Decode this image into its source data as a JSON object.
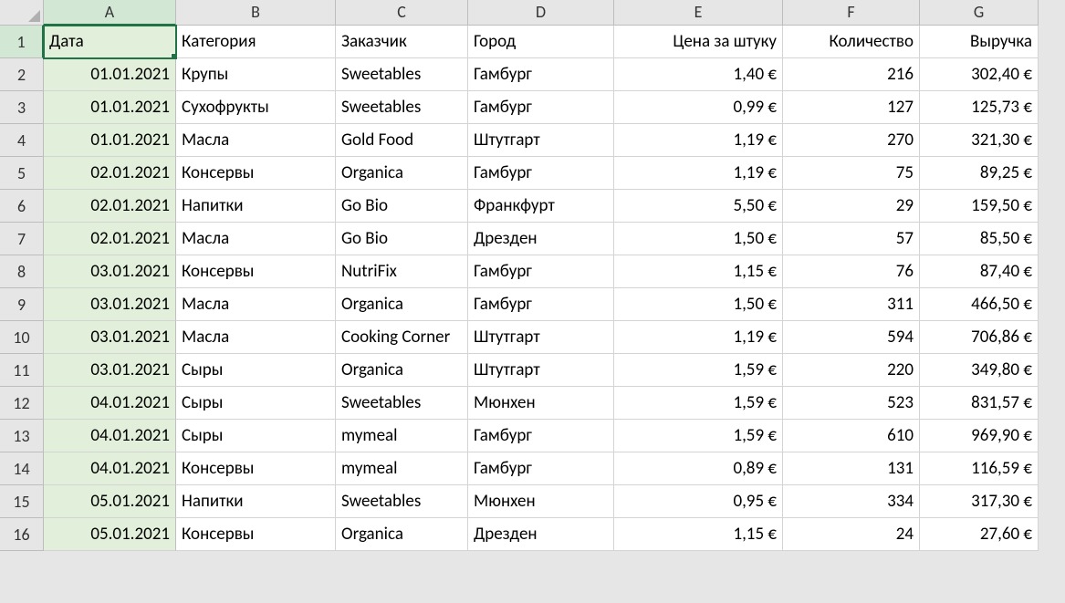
{
  "columns": [
    "A",
    "B",
    "C",
    "D",
    "E",
    "F",
    "G"
  ],
  "selected_column": "A",
  "selected_row": 1,
  "active_cell": "A1",
  "headers": {
    "A": "Дата",
    "B": "Категория",
    "C": "Заказчик",
    "D": "Город",
    "E": "Цена за штуку",
    "F": "Количество",
    "G": "Выручка"
  },
  "rows": [
    {
      "n": 2,
      "A": "01.01.2021",
      "B": "Крупы",
      "C": "Sweetables",
      "D": "Гамбург",
      "E": "1,40 €",
      "F": "216",
      "G": "302,40 €"
    },
    {
      "n": 3,
      "A": "01.01.2021",
      "B": "Сухофрукты",
      "C": "Sweetables",
      "D": "Гамбург",
      "E": "0,99 €",
      "F": "127",
      "G": "125,73 €"
    },
    {
      "n": 4,
      "A": "01.01.2021",
      "B": "Масла",
      "C": "Gold Food",
      "D": "Штутгарт",
      "E": "1,19 €",
      "F": "270",
      "G": "321,30 €"
    },
    {
      "n": 5,
      "A": "02.01.2021",
      "B": "Консервы",
      "C": "Organica",
      "D": "Гамбург",
      "E": "1,19 €",
      "F": "75",
      "G": "89,25 €"
    },
    {
      "n": 6,
      "A": "02.01.2021",
      "B": "Напитки",
      "C": "Go Bio",
      "D": "Франкфурт",
      "E": "5,50 €",
      "F": "29",
      "G": "159,50 €"
    },
    {
      "n": 7,
      "A": "02.01.2021",
      "B": "Масла",
      "C": "Go Bio",
      "D": "Дрезден",
      "E": "1,50 €",
      "F": "57",
      "G": "85,50 €"
    },
    {
      "n": 8,
      "A": "03.01.2021",
      "B": "Консервы",
      "C": "NutriFix",
      "D": "Гамбург",
      "E": "1,15 €",
      "F": "76",
      "G": "87,40 €"
    },
    {
      "n": 9,
      "A": "03.01.2021",
      "B": "Масла",
      "C": "Organica",
      "D": "Гамбург",
      "E": "1,50 €",
      "F": "311",
      "G": "466,50 €"
    },
    {
      "n": 10,
      "A": "03.01.2021",
      "B": "Масла",
      "C": "Cooking Corner",
      "D": "Штутгарт",
      "E": "1,19 €",
      "F": "594",
      "G": "706,86 €"
    },
    {
      "n": 11,
      "A": "03.01.2021",
      "B": "Сыры",
      "C": "Organica",
      "D": "Штутгарт",
      "E": "1,59 €",
      "F": "220",
      "G": "349,80 €"
    },
    {
      "n": 12,
      "A": "04.01.2021",
      "B": "Сыры",
      "C": "Sweetables",
      "D": "Мюнхен",
      "E": "1,59 €",
      "F": "523",
      "G": "831,57 €"
    },
    {
      "n": 13,
      "A": "04.01.2021",
      "B": "Сыры",
      "C": "mymeal",
      "D": "Гамбург",
      "E": "1,59 €",
      "F": "610",
      "G": "969,90 €"
    },
    {
      "n": 14,
      "A": "04.01.2021",
      "B": "Консервы",
      "C": "mymeal",
      "D": "Гамбург",
      "E": "0,89 €",
      "F": "131",
      "G": "116,59 €"
    },
    {
      "n": 15,
      "A": "05.01.2021",
      "B": "Напитки",
      "C": "Sweetables",
      "D": "Мюнхен",
      "E": "0,95 €",
      "F": "334",
      "G": "317,30 €"
    },
    {
      "n": 16,
      "A": "05.01.2021",
      "B": "Консервы",
      "C": "Organica",
      "D": "Дрезден",
      "E": "1,15 €",
      "F": "24",
      "G": "27,60 €"
    }
  ],
  "chart_data": {
    "type": "table",
    "title": "",
    "columns": [
      "Дата",
      "Категория",
      "Заказчик",
      "Город",
      "Цена за штуку",
      "Количество",
      "Выручка"
    ],
    "data": [
      [
        "01.01.2021",
        "Крупы",
        "Sweetables",
        "Гамбург",
        "1,40 €",
        216,
        "302,40 €"
      ],
      [
        "01.01.2021",
        "Сухофрукты",
        "Sweetables",
        "Гамбург",
        "0,99 €",
        127,
        "125,73 €"
      ],
      [
        "01.01.2021",
        "Масла",
        "Gold Food",
        "Штутгарт",
        "1,19 €",
        270,
        "321,30 €"
      ],
      [
        "02.01.2021",
        "Консервы",
        "Organica",
        "Гамбург",
        "1,19 €",
        75,
        "89,25 €"
      ],
      [
        "02.01.2021",
        "Напитки",
        "Go Bio",
        "Франкфурт",
        "5,50 €",
        29,
        "159,50 €"
      ],
      [
        "02.01.2021",
        "Масла",
        "Go Bio",
        "Дрезден",
        "1,50 €",
        57,
        "85,50 €"
      ],
      [
        "03.01.2021",
        "Консервы",
        "NutriFix",
        "Гамбург",
        "1,15 €",
        76,
        "87,40 €"
      ],
      [
        "03.01.2021",
        "Масла",
        "Organica",
        "Гамбург",
        "1,50 €",
        311,
        "466,50 €"
      ],
      [
        "03.01.2021",
        "Масла",
        "Cooking Corner",
        "Штутгарт",
        "1,19 €",
        594,
        "706,86 €"
      ],
      [
        "03.01.2021",
        "Сыры",
        "Organica",
        "Штутгарт",
        "1,59 €",
        220,
        "349,80 €"
      ],
      [
        "04.01.2021",
        "Сыры",
        "Sweetables",
        "Мюнхен",
        "1,59 €",
        523,
        "831,57 €"
      ],
      [
        "04.01.2021",
        "Сыры",
        "mymeal",
        "Гамбург",
        "1,59 €",
        610,
        "969,90 €"
      ],
      [
        "04.01.2021",
        "Консервы",
        "mymeal",
        "Гамбург",
        "0,89 €",
        131,
        "116,59 €"
      ],
      [
        "05.01.2021",
        "Напитки",
        "Sweetables",
        "Мюнхен",
        "0,95 €",
        334,
        "317,30 €"
      ],
      [
        "05.01.2021",
        "Консервы",
        "Organica",
        "Дрезден",
        "1,15 €",
        24,
        "27,60 €"
      ]
    ]
  }
}
